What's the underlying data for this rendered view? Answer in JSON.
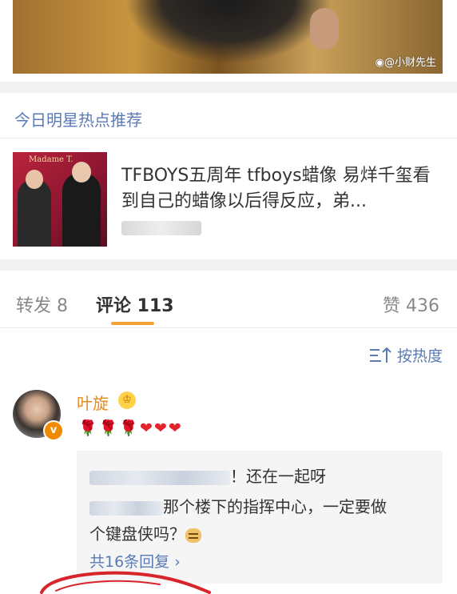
{
  "top_image": {
    "watermark": "@小财先生"
  },
  "hot_section": {
    "title": "今日明星热点推荐"
  },
  "news": {
    "title": "TFBOYS五周年 tfboys蜡像 易烊千玺看到自己的蜡像以后得反应，弟...",
    "thumb_sign": "Madame T."
  },
  "tabs": {
    "forward": "转发 8",
    "comments": "评论 113",
    "likes": "赞 436"
  },
  "sort": {
    "label": "按热度"
  },
  "comment": {
    "username": "叶旋",
    "crown_badge": "♔",
    "verified_badge": "v",
    "emojis": [
      "rose-emoji",
      "rose-emoji",
      "rose-emoji",
      "heart-emoji",
      "heart-emoji",
      "heart-emoji"
    ],
    "replies": [
      {
        "text": "！还在一起呀"
      },
      {
        "text": "那个楼下的指挥中心，一定要做"
      },
      {
        "text": "个键盘侠吗？"
      }
    ],
    "reply_count": "共16条回复 ›"
  },
  "colors": {
    "link_blue": "#5a7ab5",
    "username_orange": "#e58a1f",
    "tab_underline": "#f2a43a",
    "scribble_red": "#d8242b"
  }
}
